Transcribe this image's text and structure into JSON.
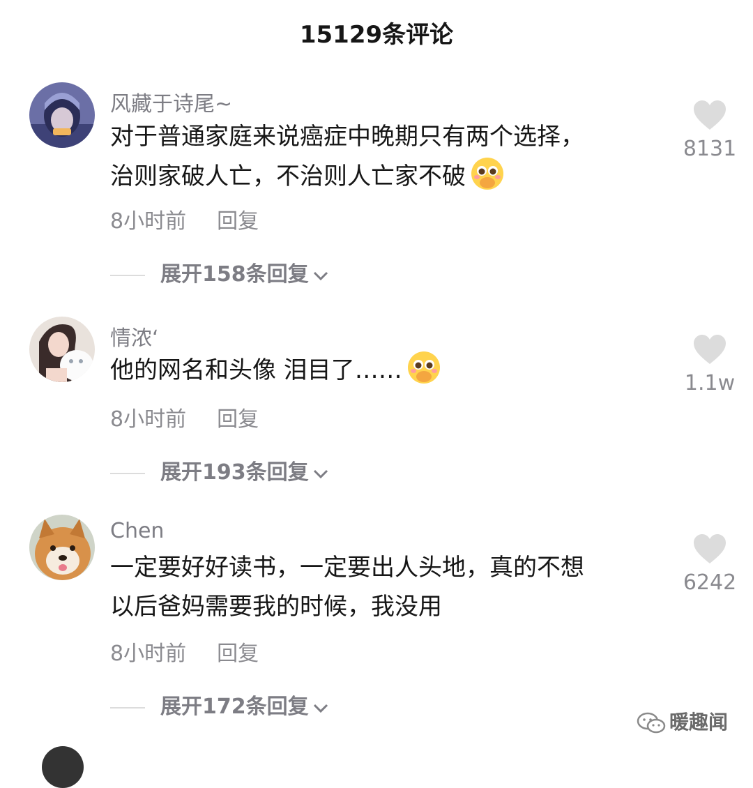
{
  "header": {
    "title": "15129条评论"
  },
  "comments": [
    {
      "username": "风藏于诗尾~",
      "lines": [
        "对于普通家庭来说癌症中晚期只有两个选择，",
        "治则家破人亡，不治则人亡家不破"
      ],
      "time": "8小时前",
      "reply_label": "回复",
      "expand_label": "展开158条回复",
      "likes": "8131"
    },
    {
      "username": "情浓‘",
      "lines": [
        "他的网名和头像 泪目了……"
      ],
      "time": "8小时前",
      "reply_label": "回复",
      "expand_label": "展开193条回复",
      "likes": "1.1w"
    },
    {
      "username": "Chen",
      "lines": [
        "一定要好好读书，一定要出人头地，真的不想",
        "以后爸妈需要我的时候，我没用"
      ],
      "time": "8小时前",
      "reply_label": "回复",
      "expand_label": "展开172条回复",
      "likes": "6242"
    }
  ],
  "watermark": {
    "text": "暖趣闻"
  },
  "icons": {
    "like": "heart-icon",
    "expand": "chevron-down-icon",
    "emoji": "pleading-face-emoji",
    "watermark": "wechat-icon"
  },
  "colors": {
    "text": "#161616",
    "secondary": "#8a8a8f",
    "like": "#dcdcdc"
  }
}
